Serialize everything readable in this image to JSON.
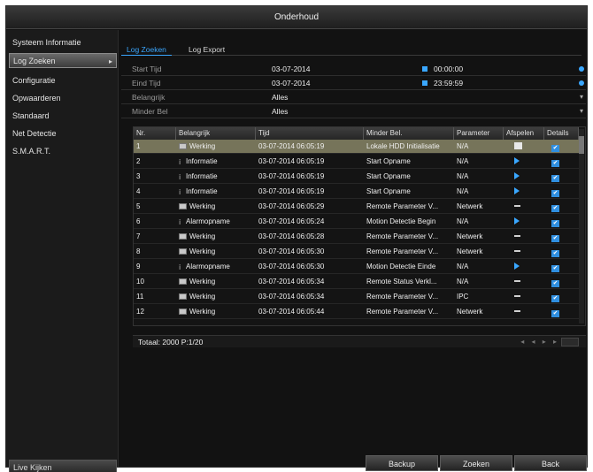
{
  "window": {
    "title": "Onderhoud"
  },
  "sidebar": {
    "items": [
      {
        "label": "Systeem Informatie"
      },
      {
        "label": "Log Zoeken",
        "arrow": "▸"
      },
      {
        "label": "Configuratie"
      },
      {
        "label": "Opwaarderen"
      },
      {
        "label": "Standaard"
      },
      {
        "label": "Net Detectie"
      },
      {
        "label": "S.M.A.R.T."
      }
    ],
    "live_button": "Live Kijken"
  },
  "tabs": [
    {
      "label": "Log Zoeken"
    },
    {
      "label": "Log Export"
    }
  ],
  "filters": {
    "start_label": "Start Tijd",
    "start_date": "03-07-2014",
    "start_time": "00:00:00",
    "end_label": "Eind Tijd",
    "end_date": "03-07-2014",
    "end_time": "23:59:59",
    "priority_label": "Belangrijk",
    "priority_value": "Alles",
    "minor_label": "Minder Bel",
    "minor_value": "Alles"
  },
  "table": {
    "headers": [
      "Nr.",
      "Belangrijk",
      "Tijd",
      "Minder Bel.",
      "Parameter",
      "Afspelen",
      "Details"
    ],
    "rows": [
      {
        "nr": "1",
        "type": "Werking",
        "icon": "warn",
        "time": "03-07-2014 06:05:19",
        "minor": "Lokale HDD Initialisatie",
        "param": "N/A",
        "play": "stop",
        "selected": true
      },
      {
        "nr": "2",
        "type": "Informatie",
        "icon": "info",
        "time": "03-07-2014 06:05:19",
        "minor": "Start Opname",
        "param": "N/A",
        "play": "play"
      },
      {
        "nr": "3",
        "type": "Informatie",
        "icon": "info",
        "time": "03-07-2014 06:05:19",
        "minor": "Start Opname",
        "param": "N/A",
        "play": "play"
      },
      {
        "nr": "4",
        "type": "Informatie",
        "icon": "info",
        "time": "03-07-2014 06:05:19",
        "minor": "Start Opname",
        "param": "N/A",
        "play": "play"
      },
      {
        "nr": "5",
        "type": "Werking",
        "icon": "warn",
        "time": "03-07-2014 06:05:29",
        "minor": "Remote Parameter V...",
        "param": "Netwerk",
        "play": "dash"
      },
      {
        "nr": "6",
        "type": "Alarmopname",
        "icon": "info",
        "time": "03-07-2014 06:05:24",
        "minor": "Motion Detectie Begin",
        "param": "N/A",
        "play": "play"
      },
      {
        "nr": "7",
        "type": "Werking",
        "icon": "warn",
        "time": "03-07-2014 06:05:28",
        "minor": "Remote Parameter V...",
        "param": "Netwerk",
        "play": "dash"
      },
      {
        "nr": "8",
        "type": "Werking",
        "icon": "warn",
        "time": "03-07-2014 06:05:30",
        "minor": "Remote Parameter V...",
        "param": "Netwerk",
        "play": "dash"
      },
      {
        "nr": "9",
        "type": "Alarmopname",
        "icon": "info",
        "time": "03-07-2014 06:05:30",
        "minor": "Motion Detectie Einde",
        "param": "N/A",
        "play": "play"
      },
      {
        "nr": "10",
        "type": "Werking",
        "icon": "warn",
        "time": "03-07-2014 06:05:34",
        "minor": "Remote Status Verkl...",
        "param": "N/A",
        "play": "dash"
      },
      {
        "nr": "11",
        "type": "Werking",
        "icon": "warn",
        "time": "03-07-2014 06:05:34",
        "minor": "Remote Parameter V...",
        "param": "IPC",
        "play": "dash"
      },
      {
        "nr": "12",
        "type": "Werking",
        "icon": "warn",
        "time": "03-07-2014 06:05:44",
        "minor": "Remote Parameter V...",
        "param": "Netwerk",
        "play": "dash"
      }
    ]
  },
  "footer": {
    "total_label": "Totaal:",
    "total_value": "2000",
    "page": "P:1/20"
  },
  "buttons": {
    "backup": "Backup",
    "search": "Zoeken",
    "back": "Back"
  },
  "colors": {
    "accent": "#3aa7ff",
    "selected_row": "#76745a",
    "background": "#121212"
  },
  "icons": {
    "detail": "check-icon",
    "play": "play-icon",
    "warning": "warning-icon",
    "info": "info-icon"
  }
}
